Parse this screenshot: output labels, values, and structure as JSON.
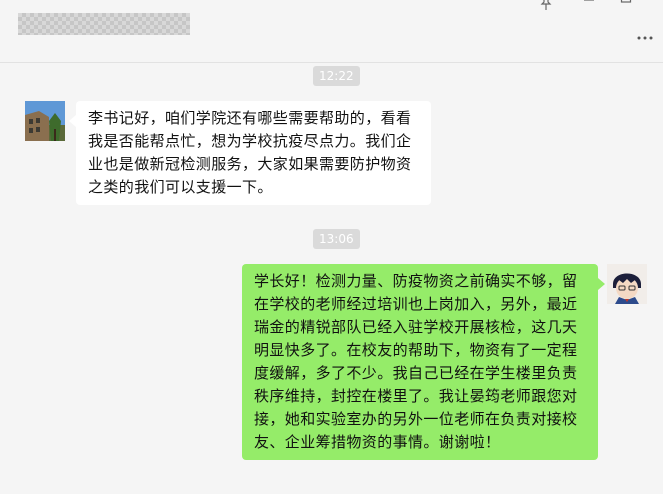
{
  "window": {
    "pin_icon": "pin-icon",
    "minimize_icon": "minimize-icon",
    "maximize_icon": "maximize-icon",
    "more_icon": "more-icon"
  },
  "messages": [
    {
      "time": "12:22",
      "side": "left",
      "text": "李书记好，咱们学院还有哪些需要帮助的，看看我是否能帮点忙，想为学校抗疫尽点力。我们企业也是做新冠检测服务，大家如果需要防护物资之类的我们可以支援一下。"
    },
    {
      "time": "13:06",
      "side": "right",
      "text": "学长好！检测力量、防疫物资之前确实不够，留在学校的老师经过培训也上岗加入，另外，最近瑞金的精锐部队已经入驻学校开展核检，这几天明显快多了。在校友的帮助下，物资有了一定程度缓解，多了不少。我自己已经在学生楼里负责秩序维持，封控在楼里了。我让晏筠老师跟您对接，她和实验室办的另外一位老师在负责对接校友、企业筹措物资的事情。谢谢啦！"
    }
  ],
  "colors": {
    "background": "#f5f5f5",
    "incoming_bubble": "#ffffff",
    "outgoing_bubble": "#95ec69",
    "timestamp_bg": "#dadada"
  }
}
